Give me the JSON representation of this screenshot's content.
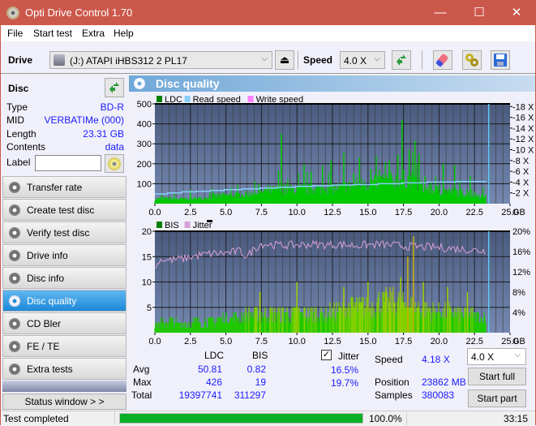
{
  "window": {
    "title": "Opti Drive Control 1.70",
    "minimize": "—",
    "maximize": "☐",
    "close": "✕"
  },
  "menu": [
    "File",
    "Start test",
    "Extra",
    "Help"
  ],
  "toolbar": {
    "drive_label": "Drive",
    "drive_value": "(J:)  ATAPI iHBS312  2 PL17",
    "speed_label": "Speed",
    "speed_value": "4.0 X",
    "chevron": "⌵",
    "eject": "⏏"
  },
  "disc": {
    "header": "Disc",
    "fields": [
      {
        "key": "Type",
        "value": "BD-R"
      },
      {
        "key": "MID",
        "value": "VERBATIMe (000)"
      },
      {
        "key": "Length",
        "value": "23.31 GB"
      },
      {
        "key": "Contents",
        "value": "data"
      }
    ],
    "label_key": "Label",
    "label_value": ""
  },
  "nav": [
    {
      "label": "Transfer rate",
      "active": false
    },
    {
      "label": "Create test disc",
      "active": false
    },
    {
      "label": "Verify test disc",
      "active": false
    },
    {
      "label": "Drive info",
      "active": false
    },
    {
      "label": "Disc info",
      "active": false
    },
    {
      "label": "Disc quality",
      "active": true
    },
    {
      "label": "CD Bler",
      "active": false
    },
    {
      "label": "FE / TE",
      "active": false
    },
    {
      "label": "Extra tests",
      "active": false
    }
  ],
  "status_window_button": "Status window > >",
  "panel": {
    "title": "Disc quality"
  },
  "chart_data": [
    {
      "type": "area",
      "title": "LDC",
      "legend": [
        {
          "name": "LDC",
          "color": "#008000"
        },
        {
          "name": "Read speed",
          "color": "#87cefa"
        },
        {
          "name": "Write speed",
          "color": "#ff80ff"
        }
      ],
      "legend_position": "top-left",
      "x_ticks": [
        "0.0",
        "2.5",
        "5.0",
        "7.5",
        "10.0",
        "12.5",
        "15.0",
        "17.5",
        "20.0",
        "22.5",
        "25.0"
      ],
      "x_unit": "GB",
      "xlim": [
        0,
        25
      ],
      "y_left_ticks": [
        "100",
        "200",
        "300",
        "400",
        "500"
      ],
      "ylim_left": [
        0,
        500
      ],
      "y_right_ticks": [
        "2 X",
        "4 X",
        "6 X",
        "8 X",
        "10 X",
        "12 X",
        "14 X",
        "16 X",
        "18 X"
      ],
      "ylim_right": [
        0,
        18.5
      ],
      "grid": true,
      "end_marker_gb": 23.5,
      "ldc_base": {
        "x": [
          0,
          1,
          2,
          3,
          4,
          5,
          6,
          7,
          8,
          9,
          10,
          11,
          12,
          13,
          14,
          15,
          16,
          17,
          18,
          19,
          20,
          21,
          22,
          23.3
        ],
        "y": [
          25,
          28,
          25,
          27,
          40,
          45,
          48,
          55,
          70,
          75,
          78,
          78,
          80,
          85,
          100,
          110,
          120,
          130,
          135,
          80,
          70,
          65,
          55,
          40
        ]
      },
      "ldc_spikes": [
        {
          "x": 8.9,
          "y": 350
        },
        {
          "x": 8.7,
          "y": 165
        },
        {
          "x": 10.5,
          "y": 195
        },
        {
          "x": 11.0,
          "y": 160
        },
        {
          "x": 11.8,
          "y": 190
        },
        {
          "x": 12.4,
          "y": 215
        },
        {
          "x": 13.3,
          "y": 255
        },
        {
          "x": 14.0,
          "y": 155
        },
        {
          "x": 14.4,
          "y": 230
        },
        {
          "x": 15.2,
          "y": 175
        },
        {
          "x": 15.8,
          "y": 170
        },
        {
          "x": 16.5,
          "y": 215
        },
        {
          "x": 17.1,
          "y": 245
        },
        {
          "x": 17.4,
          "y": 420
        },
        {
          "x": 17.9,
          "y": 270
        },
        {
          "x": 18.3,
          "y": 315
        },
        {
          "x": 18.6,
          "y": 250
        },
        {
          "x": 19.0,
          "y": 140
        },
        {
          "x": 20.3,
          "y": 200
        },
        {
          "x": 21.1,
          "y": 195
        },
        {
          "x": 22.2,
          "y": 140
        },
        {
          "x": 2.5,
          "y": 70
        },
        {
          "x": 7.3,
          "y": 100
        }
      ],
      "read_speed": {
        "x": [
          0,
          0.9,
          1.9,
          2.9,
          3.9,
          4.9,
          6.1,
          7.4,
          8.6,
          9.9,
          11.1,
          12.5,
          14.0,
          15.7,
          17.4,
          19.2,
          21.2,
          23.3
        ],
        "y": [
          1.8,
          2.0,
          2.2,
          2.3,
          2.45,
          2.6,
          2.75,
          2.9,
          3.05,
          3.2,
          3.3,
          3.45,
          3.55,
          3.7,
          3.85,
          4.0,
          4.1,
          4.2
        ]
      }
    },
    {
      "type": "bar",
      "title": "BIS / Jitter",
      "legend": [
        {
          "name": "BIS",
          "color": "#008000"
        },
        {
          "name": "Jitter",
          "color": "#d8a0d8"
        }
      ],
      "legend_position": "top-left",
      "x_ticks": [
        "0.0",
        "2.5",
        "5.0",
        "7.5",
        "10.0",
        "12.5",
        "15.0",
        "17.5",
        "20.0",
        "22.5",
        "25.0"
      ],
      "x_unit": "GB",
      "xlim": [
        0,
        25
      ],
      "y_left_ticks": [
        "5",
        "10",
        "15",
        "20"
      ],
      "ylim_left": [
        0,
        20
      ],
      "y_right_ticks": [
        "4%",
        "8%",
        "12%",
        "16%",
        "20%"
      ],
      "ylim_right": [
        0,
        20
      ],
      "grid": true,
      "end_marker_gb": 23.5,
      "bis_envelope": {
        "x": [
          0,
          1,
          2,
          3,
          4,
          5,
          6,
          7,
          8,
          9,
          10,
          11,
          12,
          13,
          14,
          15,
          16,
          17,
          18,
          19,
          20,
          21,
          22,
          23.3
        ],
        "y": [
          2,
          3,
          2,
          3,
          3,
          4,
          4,
          5,
          5,
          5,
          5,
          5,
          5,
          6,
          7,
          7,
          8,
          8,
          7,
          6,
          6,
          5,
          5,
          4
        ]
      },
      "bis_spikes": [
        {
          "x": 7.4,
          "y": 8
        },
        {
          "x": 10.0,
          "y": 10
        },
        {
          "x": 13.3,
          "y": 9
        },
        {
          "x": 15.0,
          "y": 10
        },
        {
          "x": 17.3,
          "y": 11
        },
        {
          "x": 17.8,
          "y": 15
        },
        {
          "x": 18.2,
          "y": 19
        },
        {
          "x": 18.9,
          "y": 10
        },
        {
          "x": 20.6,
          "y": 9
        },
        {
          "x": 22.0,
          "y": 8
        }
      ],
      "jitter": {
        "x": [
          0,
          0.3,
          1,
          2,
          3,
          4,
          5,
          6,
          6.5,
          7,
          7.5,
          8,
          9,
          10,
          11,
          12,
          13,
          14,
          15,
          16,
          17,
          18,
          19,
          20,
          21,
          22,
          23.3
        ],
        "y": [
          12.0,
          14.5,
          14.3,
          14.6,
          15.2,
          15.6,
          15.7,
          16.1,
          15.0,
          16.6,
          17.5,
          17.4,
          17.2,
          17.3,
          17.4,
          17.3,
          17.4,
          17.2,
          17.3,
          17.4,
          17.2,
          17.0,
          16.9,
          16.8,
          16.6,
          16.4,
          16.1
        ]
      }
    }
  ],
  "stats": {
    "col_ldc": "LDC",
    "col_bis": "BIS",
    "jitter_label": "Jitter",
    "jitter_checked": true,
    "rows": [
      {
        "label": "Avg",
        "ldc": "50.81",
        "bis": "0.82",
        "jitter": "16.5%"
      },
      {
        "label": "Max",
        "ldc": "426",
        "bis": "19",
        "jitter": "19.7%"
      },
      {
        "label": "Total",
        "ldc": "19397741",
        "bis": "311297",
        "jitter": ""
      }
    ],
    "speed_label": "Speed",
    "speed_value": "4.18 X",
    "position_label": "Position",
    "position_value": "23862 MB",
    "samples_label": "Samples",
    "samples_value": "380083",
    "speed_select": "4.0 X",
    "start_full": "Start full",
    "start_part": "Start part"
  },
  "statusbar": {
    "text": "Test completed",
    "progress": 100.0,
    "progress_text": "100.0%",
    "time": "33:15"
  }
}
